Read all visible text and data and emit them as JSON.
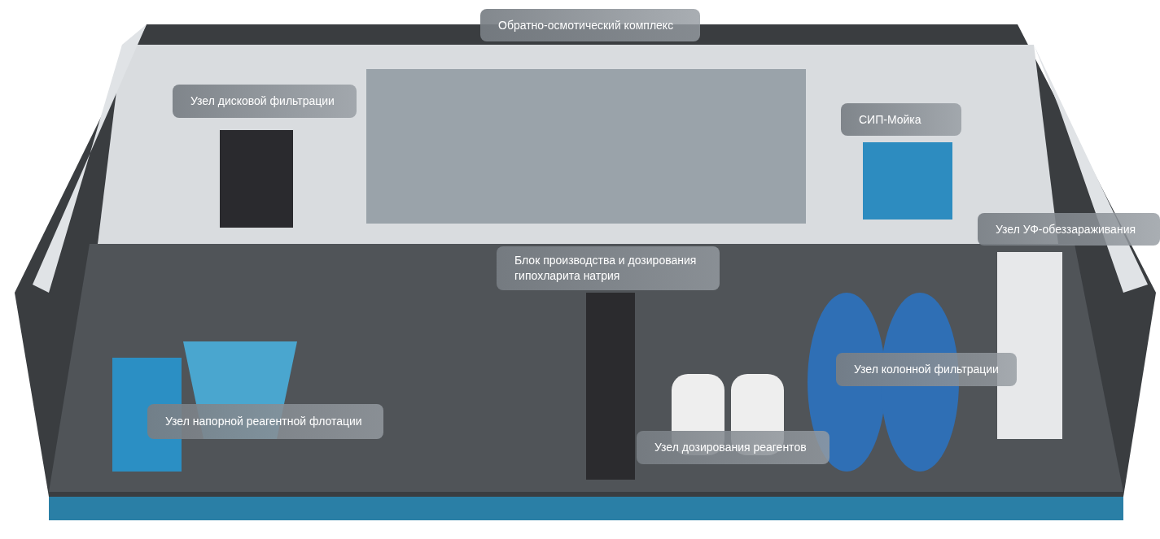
{
  "scene": {
    "labels": [
      {
        "text": "Обратно-осмотический комплекс"
      },
      {
        "text": "Узел дисковой фильтрации"
      },
      {
        "text": "СИП-Мойка"
      },
      {
        "text": "Узел УФ-обеззараживания"
      },
      {
        "text": "Блок производства и дозирования гипохларита натрия"
      },
      {
        "text": "Узел колонной фильтрации"
      },
      {
        "text": "Узел напорной реагентной флотации"
      },
      {
        "text": "Узел дозирования реагентов"
      }
    ]
  }
}
